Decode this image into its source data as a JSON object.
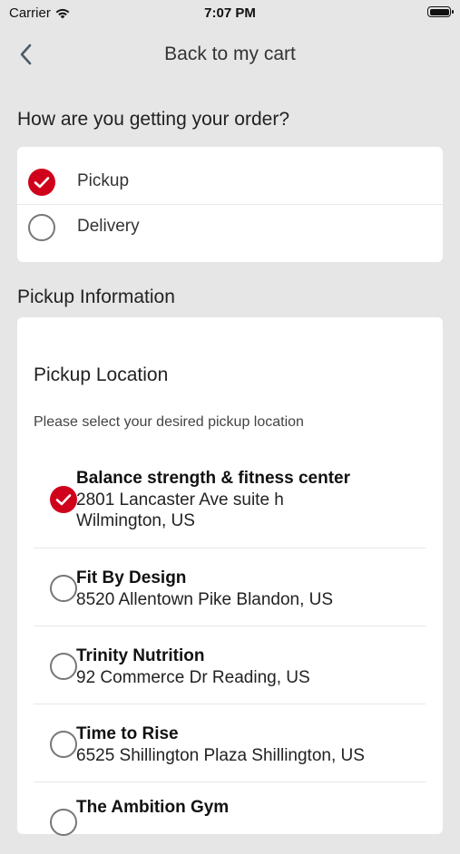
{
  "status_bar": {
    "carrier": "Carrier",
    "time": "7:07 PM"
  },
  "nav": {
    "title": "Back to my cart",
    "back_icon": "chevron-left-icon"
  },
  "fulfillment": {
    "heading": "How are you getting your order?",
    "options": [
      {
        "label": "Pickup",
        "selected": true
      },
      {
        "label": "Delivery",
        "selected": false
      }
    ]
  },
  "pickup_info": {
    "heading": "Pickup Information",
    "location_heading": "Pickup Location",
    "subtitle": "Please select your desired pickup location",
    "locations": [
      {
        "name": "Balance strength & fitness center",
        "address_line1": "2801 Lancaster Ave suite h",
        "address_line2": "Wilmington, US",
        "selected": true
      },
      {
        "name": "Fit By Design",
        "address_line1": "8520 Allentown Pike Blandon, US",
        "address_line2": "",
        "selected": false
      },
      {
        "name": "Trinity Nutrition",
        "address_line1": "92 Commerce Dr Reading, US",
        "address_line2": "",
        "selected": false
      },
      {
        "name": "Time to Rise",
        "address_line1": "6525 Shillington Plaza Shillington, US",
        "address_line2": "",
        "selected": false
      },
      {
        "name": "The Ambition Gym",
        "address_line1": "",
        "address_line2": "",
        "selected": false
      }
    ]
  },
  "colors": {
    "accent": "#d0021b",
    "background": "#e6e6e6",
    "card": "#ffffff"
  }
}
